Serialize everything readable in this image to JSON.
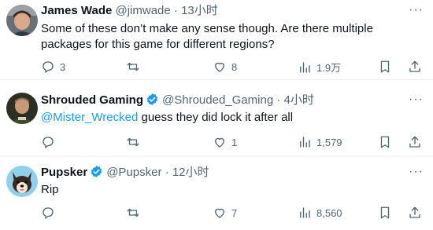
{
  "tweets": [
    {
      "name": "James Wade",
      "handle": "@jimwade",
      "dot": "·",
      "time": "13小时",
      "more": "···",
      "text": "Some of these don’t make any sense though. Are there multiple packages for this game for different regions?",
      "verified": false,
      "replies": "3",
      "retweets": "",
      "likes": "8",
      "views": "1.9万"
    },
    {
      "name": "Shrouded Gaming",
      "handle": "@Shrouded_Gaming",
      "dot": "·",
      "time": "4小时",
      "more": "···",
      "mention": "@Mister_Wrecked",
      "text": " guess they did lock it after all",
      "verified": true,
      "replies": "",
      "retweets": "",
      "likes": "1",
      "views": "1,579"
    },
    {
      "name": "Pupsker",
      "handle": "@Pupsker",
      "dot": "·",
      "time": "12小时",
      "more": "···",
      "text": "Rip",
      "verified": true,
      "replies": "",
      "retweets": "",
      "likes": "7",
      "views": "8,560"
    }
  ],
  "colors": {
    "accent": "#1d9bf0",
    "muted": "#536471",
    "text": "#0f1419",
    "divider": "#eff3f4"
  },
  "icons": [
    "reply-icon",
    "retweet-icon",
    "like-icon",
    "views-icon",
    "bookmark-icon",
    "share-icon",
    "more-icon",
    "verified-badge-icon"
  ]
}
